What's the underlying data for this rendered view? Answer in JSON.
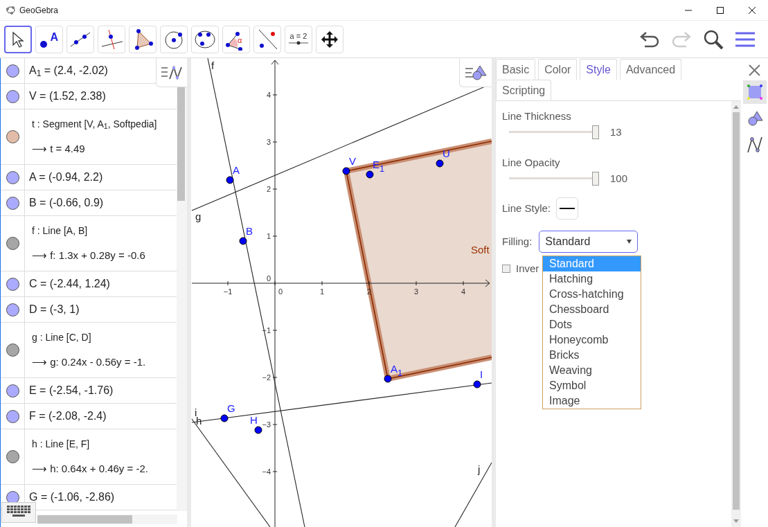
{
  "window": {
    "title": "GeoGebra"
  },
  "toolbar": {
    "tools": [
      {
        "kind": "move",
        "selected": true
      },
      {
        "kind": "point",
        "label": "A",
        "selected": false
      },
      {
        "kind": "line",
        "selected": false
      },
      {
        "kind": "perpendicular",
        "selected": false
      },
      {
        "kind": "polygon",
        "selected": false
      },
      {
        "kind": "circle",
        "selected": false
      },
      {
        "kind": "conic",
        "selected": false
      },
      {
        "kind": "angle",
        "label": "α",
        "selected": false
      },
      {
        "kind": "reflect",
        "selected": false
      },
      {
        "kind": "slider",
        "label": "a = 2",
        "selected": false
      },
      {
        "kind": "move_view",
        "selected": false
      }
    ]
  },
  "algebra": {
    "items": [
      {
        "kind": "point",
        "text": "A$_{1}$ = (2.4, -2.02)",
        "color": "#aaaaff"
      },
      {
        "kind": "point",
        "text": "V = (1.52, 2.38)",
        "color": "#aaaaff"
      },
      {
        "kind": "definition",
        "definition": "t : Segment [V, A$_{1}$, Softpedia]",
        "value": "⟶  t = 4.49",
        "color": "#e2bca8"
      },
      {
        "kind": "point",
        "text": "A = (-0.94, 2.2)",
        "color": "#aaaaff"
      },
      {
        "kind": "point",
        "text": "B = (-0.66, 0.9)",
        "color": "#aaaaff"
      },
      {
        "kind": "definition",
        "definition": "f : Line [A, B]",
        "value": "⟶  f: 1.3x + 0.28y = -0.6",
        "color": "#a6a6a6"
      },
      {
        "kind": "point",
        "text": "C = (-2.44, 1.24)",
        "color": "#aaaaff"
      },
      {
        "kind": "point",
        "text": "D = (-3, 1)",
        "color": "#aaaaff"
      },
      {
        "kind": "definition",
        "definition": "g : Line [C, D]",
        "value": "⟶  g: 0.24x - 0.56y = -1.",
        "color": "#a6a6a6"
      },
      {
        "kind": "point",
        "text": "E = (-2.54, -1.76)",
        "color": "#aaaaff"
      },
      {
        "kind": "point",
        "text": "F = (-2.08, -2.4)",
        "color": "#aaaaff"
      },
      {
        "kind": "definition",
        "definition": "h : Line [E, F]",
        "value": "⟶  h: 0.64x + 0.46y = -2.",
        "color": "#a6a6a6"
      },
      {
        "kind": "point",
        "text": "G = (-1.06, -2.86)",
        "color": "#aaaaff"
      }
    ]
  },
  "graphics": {
    "x_axis_labels": [
      "−1",
      "0",
      "1",
      "2",
      "3",
      "4"
    ],
    "y_axis_labels": [
      "4",
      "3",
      "2",
      "1",
      "0",
      "−1",
      "−2",
      "−3",
      "−4"
    ],
    "lines": [
      {
        "label": "f"
      },
      {
        "label": "g"
      },
      {
        "label": "h"
      },
      {
        "label": "i"
      },
      {
        "label": "j"
      }
    ],
    "polygon_label": "Soft",
    "points": [
      {
        "label": "A"
      },
      {
        "label": "B"
      },
      {
        "label": "V"
      },
      {
        "label": "E",
        "sub": "1"
      },
      {
        "label": "U"
      },
      {
        "label": "A",
        "sub": "1"
      },
      {
        "label": "I"
      },
      {
        "label": "G"
      },
      {
        "label": "H"
      }
    ]
  },
  "properties": {
    "tabs": [
      {
        "label": "Basic",
        "selected": false
      },
      {
        "label": "Color",
        "selected": false
      },
      {
        "label": "Style",
        "selected": true
      },
      {
        "label": "Advanced",
        "selected": false
      },
      {
        "label": "Scripting",
        "selected": false
      }
    ],
    "line_thickness": {
      "label": "Line Thickness",
      "level": 1,
      "reading": "13"
    },
    "line_opacity": {
      "label": "Line Opacity",
      "level": 1,
      "reading": "100"
    },
    "line_style": {
      "label": "Line Style:"
    },
    "filling": {
      "label": "Filling:",
      "value": "Standard",
      "options": [
        {
          "label": "Standard",
          "selected": true
        },
        {
          "label": "Hatching",
          "selected": false
        },
        {
          "label": "Cross-hatching",
          "selected": false
        },
        {
          "label": "Chessboard",
          "selected": false
        },
        {
          "label": "Dots",
          "selected": false
        },
        {
          "label": "Honeycomb",
          "selected": false
        },
        {
          "label": "Bricks",
          "selected": false
        },
        {
          "label": "Weaving",
          "selected": false
        },
        {
          "label": "Symbol",
          "selected": false
        },
        {
          "label": "Image",
          "selected": false
        }
      ]
    },
    "inverse_filling": {
      "label": "Inver",
      "checked": false
    },
    "side_views": [
      {
        "kind": "objects",
        "selected": true
      },
      {
        "kind": "graphics",
        "selected": false
      },
      {
        "kind": "algebra",
        "selected": false
      }
    ]
  }
}
